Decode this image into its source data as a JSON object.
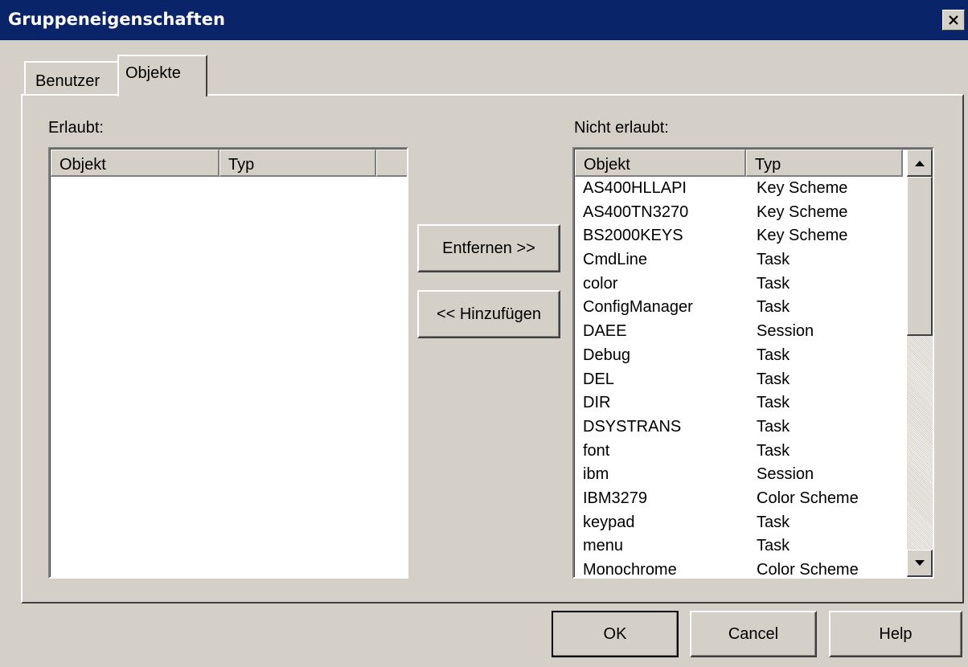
{
  "window": {
    "title": "Gruppeneigenschaften"
  },
  "tabs": [
    {
      "label": "Benutzer",
      "active": false
    },
    {
      "label": "Objekte",
      "active": true
    }
  ],
  "allowed": {
    "label": "Erlaubt:",
    "columns": [
      "Objekt",
      "Typ"
    ],
    "rows": []
  },
  "not_allowed": {
    "label": "Nicht erlaubt:",
    "columns": [
      "Objekt",
      "Typ"
    ],
    "rows": [
      [
        "AS400HLLAPI",
        "Key Scheme"
      ],
      [
        "AS400TN3270",
        "Key Scheme"
      ],
      [
        "BS2000KEYS",
        "Key Scheme"
      ],
      [
        "CmdLine",
        "Task"
      ],
      [
        "color",
        "Task"
      ],
      [
        "ConfigManager",
        "Task"
      ],
      [
        "DAEE",
        "Session"
      ],
      [
        "Debug",
        "Task"
      ],
      [
        "DEL",
        "Task"
      ],
      [
        "DIR",
        "Task"
      ],
      [
        "DSYSTRANS",
        "Task"
      ],
      [
        "font",
        "Task"
      ],
      [
        "ibm",
        "Session"
      ],
      [
        "IBM3279",
        "Color Scheme"
      ],
      [
        "keypad",
        "Task"
      ],
      [
        "menu",
        "Task"
      ],
      [
        "Monochrome",
        "Color Scheme"
      ]
    ]
  },
  "buttons": {
    "remove": "Entfernen >>",
    "add": "<< Hinzufügen",
    "ok": "OK",
    "cancel": "Cancel",
    "help": "Help"
  },
  "icons": {
    "close": "close-icon",
    "scroll_up": "arrow-up-icon",
    "scroll_down": "arrow-down-icon"
  },
  "colors": {
    "titlebar": "#0a246a",
    "face": "#d4d0c8"
  }
}
